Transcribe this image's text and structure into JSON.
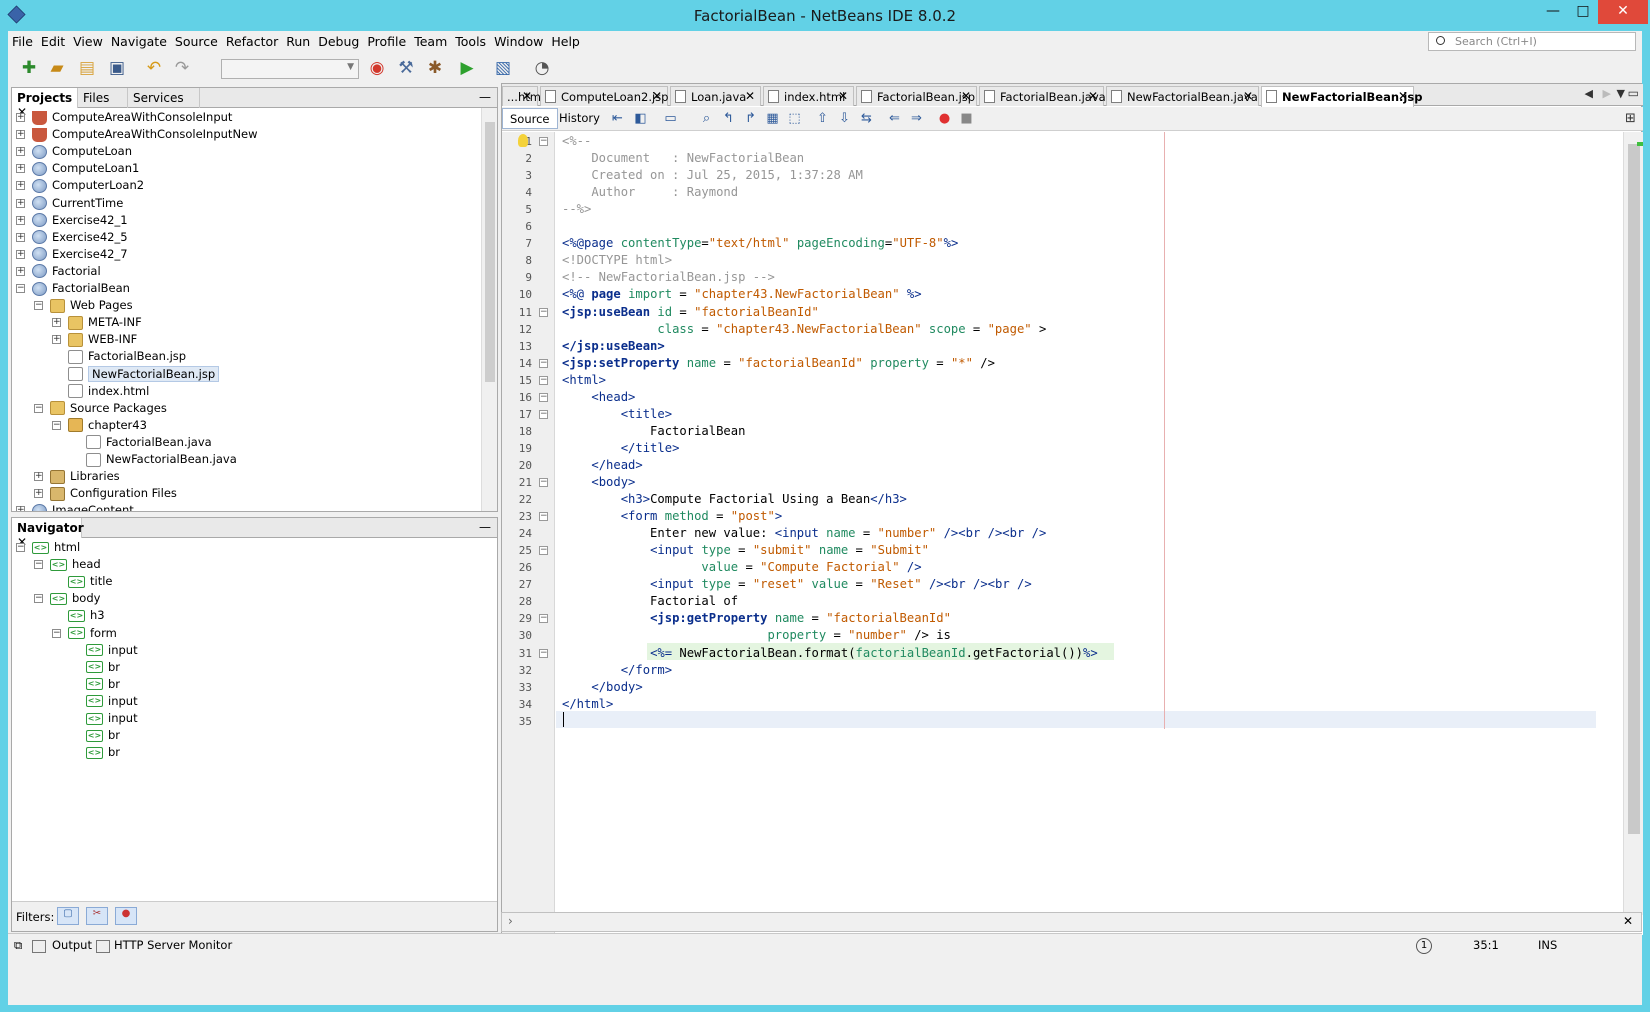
{
  "window": {
    "title": "FactorialBean - NetBeans IDE 8.0.2",
    "minimize": "—",
    "maximize": "□",
    "close": "✕"
  },
  "menu": [
    "File",
    "Edit",
    "View",
    "Navigate",
    "Source",
    "Refactor",
    "Run",
    "Debug",
    "Profile",
    "Team",
    "Tools",
    "Window",
    "Help"
  ],
  "search": {
    "placeholder": "Search (Ctrl+I)"
  },
  "projects_panel": {
    "tabs": [
      "Projects",
      "Files",
      "Services"
    ],
    "tree": [
      {
        "label": "ComputeAreaWithConsoleInput",
        "icon": "cup",
        "depth": 0,
        "exp": "+"
      },
      {
        "label": "ComputeAreaWithConsoleInputNew",
        "icon": "cup",
        "depth": 0,
        "exp": "+"
      },
      {
        "label": "ComputeLoan",
        "icon": "globe",
        "depth": 0,
        "exp": "+"
      },
      {
        "label": "ComputeLoan1",
        "icon": "globe",
        "depth": 0,
        "exp": "+"
      },
      {
        "label": "ComputerLoan2",
        "icon": "globe",
        "depth": 0,
        "exp": "+"
      },
      {
        "label": "CurrentTime",
        "icon": "globe",
        "depth": 0,
        "exp": "+"
      },
      {
        "label": "Exercise42_1",
        "icon": "globe",
        "depth": 0,
        "exp": "+"
      },
      {
        "label": "Exercise42_5",
        "icon": "globe",
        "depth": 0,
        "exp": "+"
      },
      {
        "label": "Exercise42_7",
        "icon": "globe",
        "depth": 0,
        "exp": "+"
      },
      {
        "label": "Factorial",
        "icon": "globe",
        "depth": 0,
        "exp": "+"
      },
      {
        "label": "FactorialBean",
        "icon": "globe",
        "depth": 0,
        "exp": "−"
      },
      {
        "label": "Web Pages",
        "icon": "folder",
        "depth": 1,
        "exp": "−"
      },
      {
        "label": "META-INF",
        "icon": "folder",
        "depth": 2,
        "exp": "+"
      },
      {
        "label": "WEB-INF",
        "icon": "folder",
        "depth": 2,
        "exp": "+"
      },
      {
        "label": "FactorialBean.jsp",
        "icon": "file",
        "depth": 2,
        "exp": ""
      },
      {
        "label": "NewFactorialBean.jsp",
        "icon": "file",
        "depth": 2,
        "exp": "",
        "selected": true
      },
      {
        "label": "index.html",
        "icon": "file",
        "depth": 2,
        "exp": ""
      },
      {
        "label": "Source Packages",
        "icon": "folder",
        "depth": 1,
        "exp": "−"
      },
      {
        "label": "chapter43",
        "icon": "pkg",
        "depth": 2,
        "exp": "−"
      },
      {
        "label": "FactorialBean.java",
        "icon": "jfile",
        "depth": 3,
        "exp": ""
      },
      {
        "label": "NewFactorialBean.java",
        "icon": "jfile",
        "depth": 3,
        "exp": ""
      },
      {
        "label": "Libraries",
        "icon": "lib",
        "depth": 1,
        "exp": "+"
      },
      {
        "label": "Configuration Files",
        "icon": "lib",
        "depth": 1,
        "exp": "+"
      },
      {
        "label": "ImageContent",
        "icon": "globe",
        "depth": 0,
        "exp": "+"
      }
    ]
  },
  "navigator_panel": {
    "title": "Navigator",
    "tree": [
      {
        "label": "html",
        "depth": 0,
        "exp": "−"
      },
      {
        "label": "head",
        "depth": 1,
        "exp": "−"
      },
      {
        "label": "title",
        "depth": 2,
        "exp": ""
      },
      {
        "label": "body",
        "depth": 1,
        "exp": "−"
      },
      {
        "label": "h3",
        "depth": 2,
        "exp": ""
      },
      {
        "label": "form",
        "depth": 2,
        "exp": "−"
      },
      {
        "label": "input",
        "depth": 3,
        "exp": ""
      },
      {
        "label": "br",
        "depth": 3,
        "exp": ""
      },
      {
        "label": "br",
        "depth": 3,
        "exp": ""
      },
      {
        "label": "input",
        "depth": 3,
        "exp": ""
      },
      {
        "label": "input",
        "depth": 3,
        "exp": ""
      },
      {
        "label": "br",
        "depth": 3,
        "exp": ""
      },
      {
        "label": "br",
        "depth": 3,
        "exp": ""
      }
    ],
    "filters_label": "Filters:"
  },
  "editor": {
    "tabs": [
      {
        "label": "...htm",
        "active": false
      },
      {
        "label": "ComputeLoan2.jsp",
        "active": false
      },
      {
        "label": "Loan.java",
        "active": false
      },
      {
        "label": "index.html",
        "active": false
      },
      {
        "label": "FactorialBean.jsp",
        "active": false
      },
      {
        "label": "FactorialBean.java",
        "active": false
      },
      {
        "label": "NewFactorialBean.java",
        "active": false
      },
      {
        "label": "NewFactorialBean.jsp",
        "active": true
      }
    ],
    "view_tabs": [
      "Source",
      "History"
    ],
    "lines": [
      [
        [
          "cm",
          "<%--"
        ]
      ],
      [
        [
          "cm",
          "    Document   : NewFactorialBean"
        ]
      ],
      [
        [
          "cm",
          "    Created on : Jul 25, 2015, 1:37:28 AM"
        ]
      ],
      [
        [
          "cm",
          "    Author     : Raymond"
        ]
      ],
      [
        [
          "cm",
          "--%>"
        ]
      ],
      [],
      [
        [
          "tg",
          "<%@page "
        ],
        [
          "at",
          "contentType"
        ],
        [
          "tx",
          "="
        ],
        [
          "st",
          "\"text/html\""
        ],
        [
          "tx",
          " "
        ],
        [
          "at",
          "pageEncoding"
        ],
        [
          "tx",
          "="
        ],
        [
          "st",
          "\"UTF-8\""
        ],
        [
          "tg",
          "%>"
        ]
      ],
      [
        [
          "cm",
          "<!DOCTYPE html>"
        ]
      ],
      [
        [
          "cm",
          "<!-- NewFactorialBean.jsp -->"
        ]
      ],
      [
        [
          "tg",
          "<%@ "
        ],
        [
          "jk",
          "page"
        ],
        [
          "tx",
          " "
        ],
        [
          "at",
          "import"
        ],
        [
          "tx",
          " = "
        ],
        [
          "st",
          "\"chapter43.NewFactorialBean\""
        ],
        [
          "tx",
          " "
        ],
        [
          "tg",
          "%>"
        ]
      ],
      [
        [
          "jk",
          "<jsp:useBean"
        ],
        [
          "tx",
          " "
        ],
        [
          "at",
          "id"
        ],
        [
          "tx",
          " = "
        ],
        [
          "st",
          "\"factorialBeanId\""
        ]
      ],
      [
        [
          "tx",
          "             "
        ],
        [
          "at",
          "class"
        ],
        [
          "tx",
          " = "
        ],
        [
          "st",
          "\"chapter43.NewFactorialBean\""
        ],
        [
          "tx",
          " "
        ],
        [
          "at",
          "scope"
        ],
        [
          "tx",
          " = "
        ],
        [
          "st",
          "\"page\""
        ],
        [
          "tx",
          " >"
        ]
      ],
      [
        [
          "jk",
          "</jsp:useBean>"
        ]
      ],
      [
        [
          "jk",
          "<jsp:setProperty"
        ],
        [
          "tx",
          " "
        ],
        [
          "at",
          "name"
        ],
        [
          "tx",
          " = "
        ],
        [
          "st",
          "\"factorialBeanId\""
        ],
        [
          "tx",
          " "
        ],
        [
          "at",
          "property"
        ],
        [
          "tx",
          " = "
        ],
        [
          "st",
          "\"*\""
        ],
        [
          "tx",
          " />"
        ]
      ],
      [
        [
          "tg",
          "<html>"
        ]
      ],
      [
        [
          "tx",
          "    "
        ],
        [
          "tg",
          "<head>"
        ]
      ],
      [
        [
          "tx",
          "        "
        ],
        [
          "tg",
          "<title>"
        ]
      ],
      [
        [
          "tx",
          "            FactorialBean"
        ]
      ],
      [
        [
          "tx",
          "        "
        ],
        [
          "tg",
          "</title>"
        ]
      ],
      [
        [
          "tx",
          "    "
        ],
        [
          "tg",
          "</head>"
        ]
      ],
      [
        [
          "tx",
          "    "
        ],
        [
          "tg",
          "<body>"
        ]
      ],
      [
        [
          "tx",
          "        "
        ],
        [
          "tg",
          "<h3>"
        ],
        [
          "tx",
          "Compute Factorial Using a Bean"
        ],
        [
          "tg",
          "</h3>"
        ]
      ],
      [
        [
          "tx",
          "        "
        ],
        [
          "tg",
          "<form "
        ],
        [
          "at",
          "method"
        ],
        [
          "tx",
          " = "
        ],
        [
          "st",
          "\"post\""
        ],
        [
          "tg",
          ">"
        ]
      ],
      [
        [
          "tx",
          "            Enter new value: "
        ],
        [
          "tg",
          "<input "
        ],
        [
          "at",
          "name"
        ],
        [
          "tx",
          " = "
        ],
        [
          "st",
          "\"number\""
        ],
        [
          "tx",
          " "
        ],
        [
          "tg",
          "/><br /><br />"
        ]
      ],
      [
        [
          "tx",
          "            "
        ],
        [
          "tg",
          "<input "
        ],
        [
          "at",
          "type"
        ],
        [
          "tx",
          " = "
        ],
        [
          "st",
          "\"submit\""
        ],
        [
          "tx",
          " "
        ],
        [
          "at",
          "name"
        ],
        [
          "tx",
          " = "
        ],
        [
          "st",
          "\"Submit\""
        ]
      ],
      [
        [
          "tx",
          "                   "
        ],
        [
          "at",
          "value"
        ],
        [
          "tx",
          " = "
        ],
        [
          "st",
          "\"Compute Factorial\""
        ],
        [
          "tx",
          " "
        ],
        [
          "tg",
          "/>"
        ]
      ],
      [
        [
          "tx",
          "            "
        ],
        [
          "tg",
          "<input "
        ],
        [
          "at",
          "type"
        ],
        [
          "tx",
          " = "
        ],
        [
          "st",
          "\"reset\""
        ],
        [
          "tx",
          " "
        ],
        [
          "at",
          "value"
        ],
        [
          "tx",
          " = "
        ],
        [
          "st",
          "\"Reset\""
        ],
        [
          "tx",
          " "
        ],
        [
          "tg",
          "/><br /><br />"
        ]
      ],
      [
        [
          "tx",
          "            Factorial of"
        ]
      ],
      [
        [
          "tx",
          "            "
        ],
        [
          "jk",
          "<jsp:getProperty"
        ],
        [
          "tx",
          " "
        ],
        [
          "at",
          "name"
        ],
        [
          "tx",
          " = "
        ],
        [
          "st",
          "\"factorialBeanId\""
        ]
      ],
      [
        [
          "tx",
          "                            "
        ],
        [
          "at",
          "property"
        ],
        [
          "tx",
          " = "
        ],
        [
          "st",
          "\"number\""
        ],
        [
          "tx",
          " /> is"
        ]
      ],
      [
        [
          "tx",
          "            "
        ],
        [
          "tg",
          "<%= "
        ],
        [
          "tx",
          "NewFactorialBean."
        ],
        [
          "tx",
          "format("
        ],
        [
          "at",
          "factorialBeanId"
        ],
        [
          "tx",
          ".getFactorial())"
        ],
        [
          "tg",
          "%>"
        ]
      ],
      [
        [
          "tx",
          "        "
        ],
        [
          "tg",
          "</form>"
        ]
      ],
      [
        [
          "tx",
          "    "
        ],
        [
          "tg",
          "</body>"
        ]
      ],
      [
        [
          "tg",
          "</html>"
        ]
      ],
      []
    ],
    "fold_lines": [
      1,
      11,
      14,
      15,
      16,
      17,
      21,
      23,
      25,
      29,
      31
    ]
  },
  "statusbar": {
    "output": "Output",
    "http_monitor": "HTTP Server Monitor",
    "position": "35:1",
    "mode": "INS",
    "notifications": "1"
  }
}
